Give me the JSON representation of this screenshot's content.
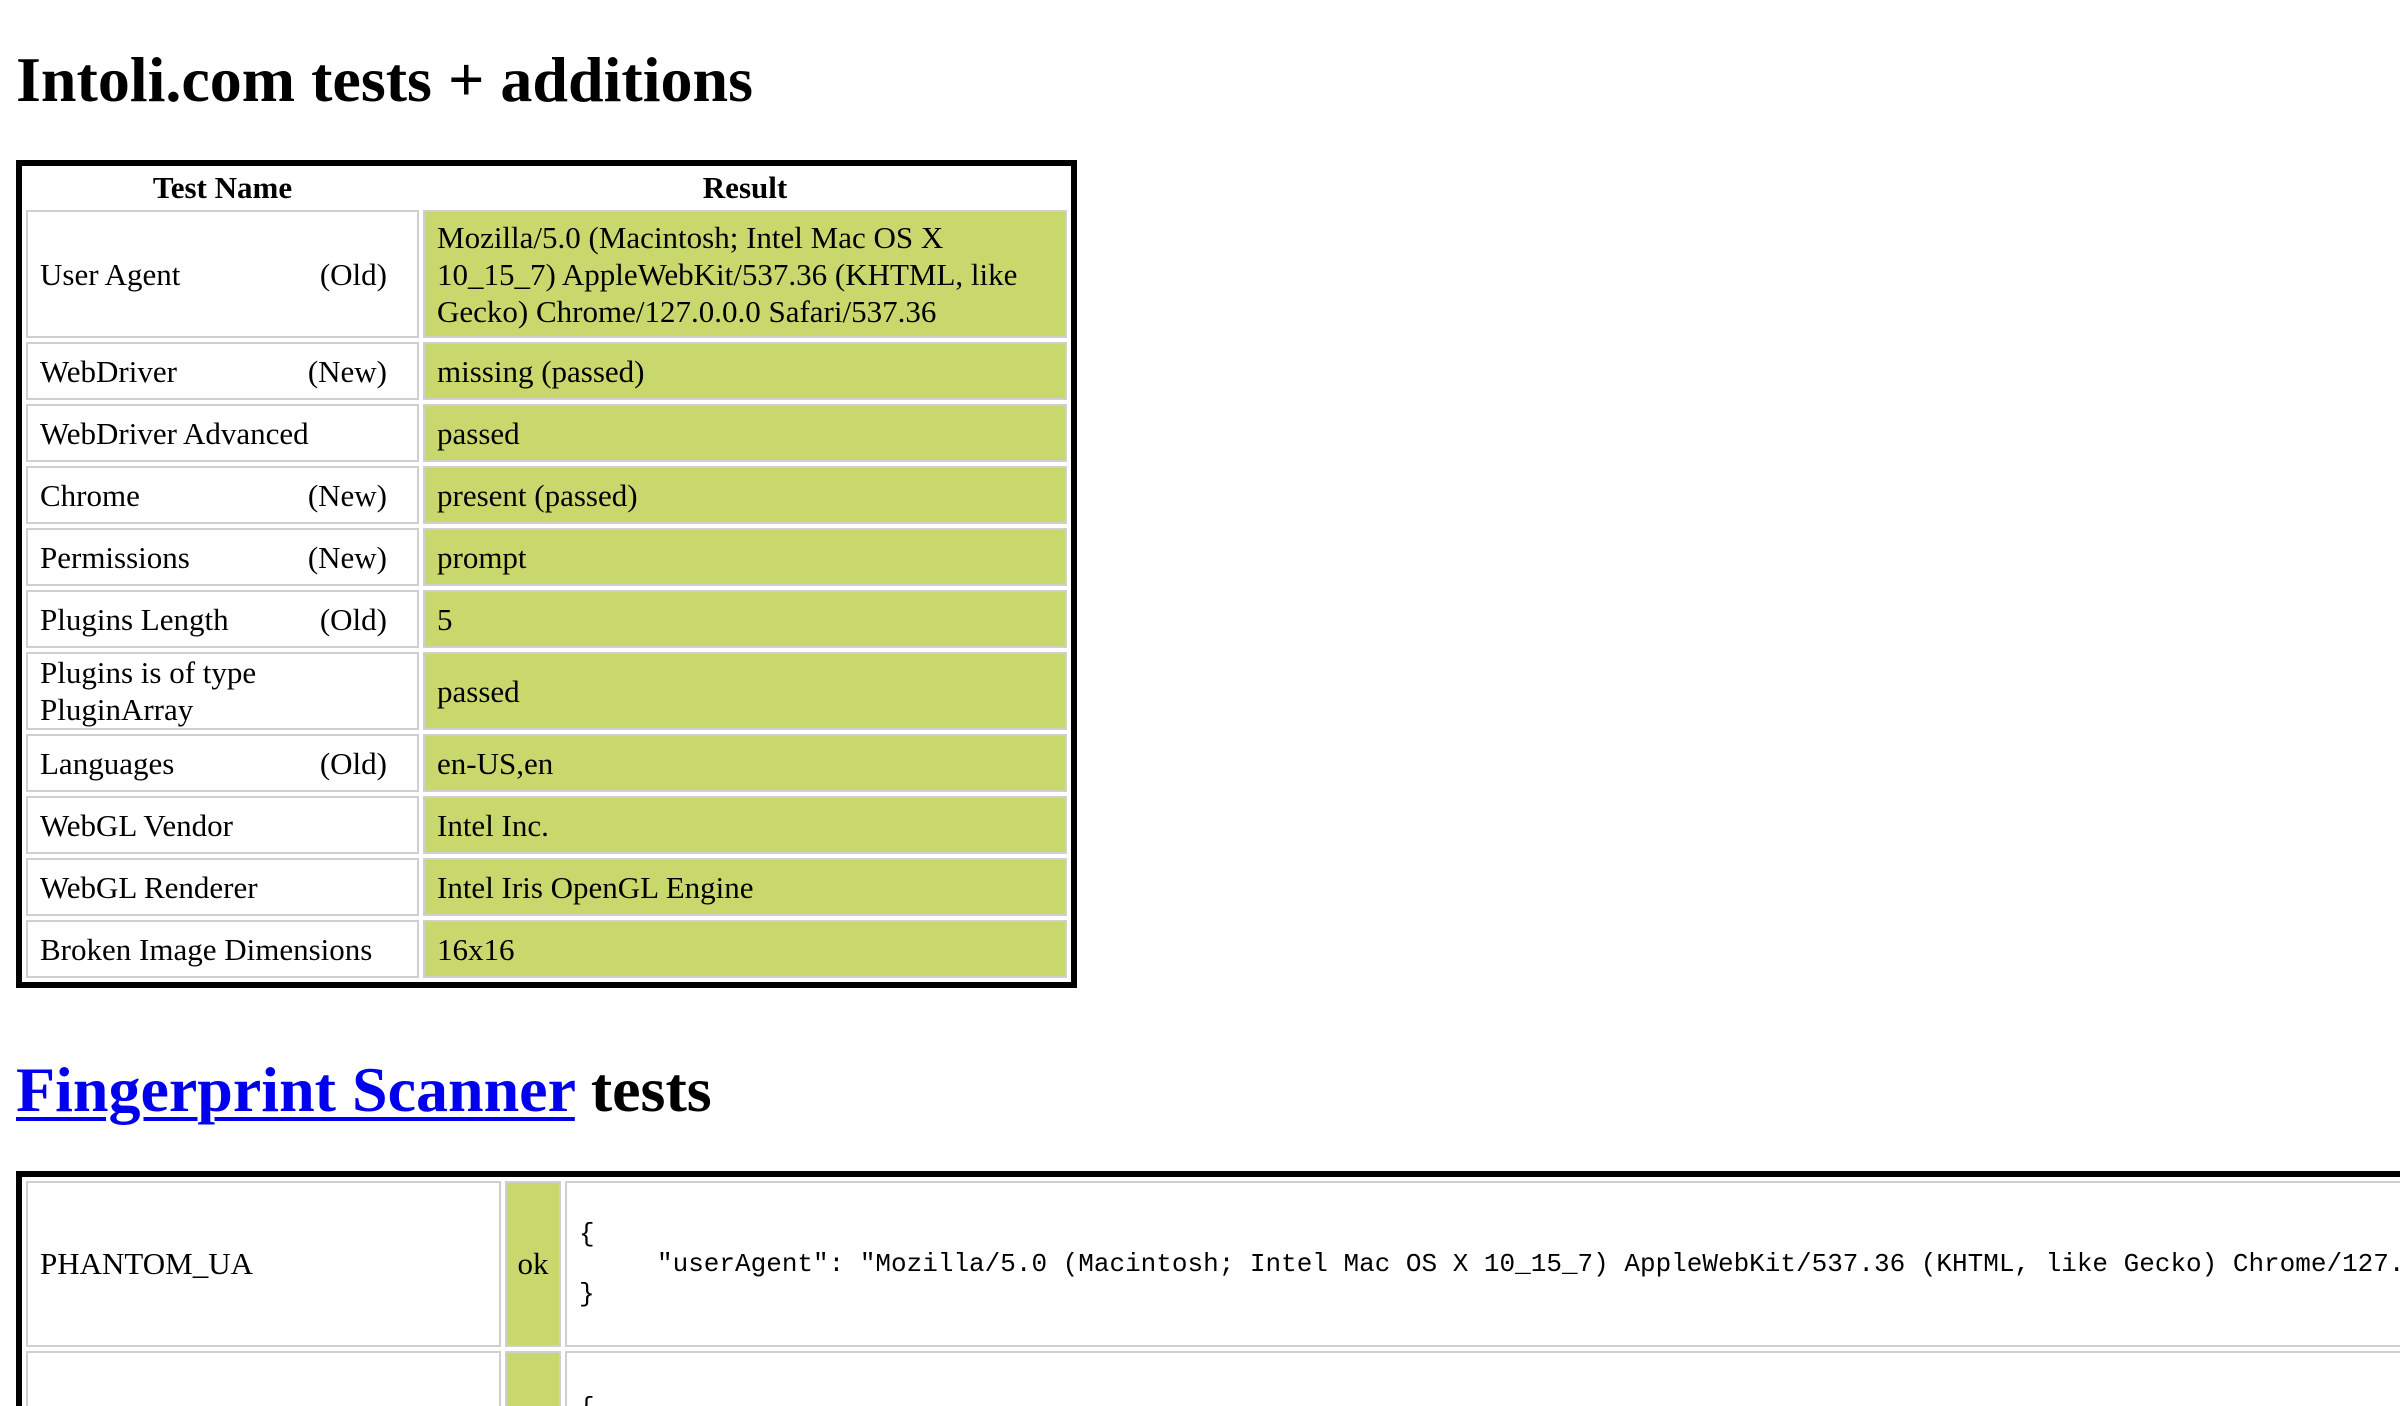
{
  "section1": {
    "title": "Intoli.com tests + additions",
    "headers": {
      "name": "Test Name",
      "result": "Result"
    },
    "rows": [
      {
        "name": "User Agent",
        "tag": "(Old)",
        "result": "Mozilla/5.0 (Macintosh; Intel Mac OS X 10_15_7) AppleWebKit/537.36 (KHTML, like Gecko) Chrome/127.0.0.0 Safari/537.36"
      },
      {
        "name": "WebDriver",
        "tag": "(New)",
        "result": "missing (passed)"
      },
      {
        "name": "WebDriver Advanced",
        "tag": "",
        "result": "passed"
      },
      {
        "name": "Chrome",
        "tag": "(New)",
        "result": "present (passed)"
      },
      {
        "name": "Permissions",
        "tag": "(New)",
        "result": "prompt"
      },
      {
        "name": "Plugins Length",
        "tag": "(Old)",
        "result": "5"
      },
      {
        "name": "Plugins is of type PluginArray",
        "tag": "",
        "result": "passed"
      },
      {
        "name": "Languages",
        "tag": "(Old)",
        "result": "en-US,en"
      },
      {
        "name": "WebGL Vendor",
        "tag": "",
        "result": "Intel Inc."
      },
      {
        "name": "WebGL Renderer",
        "tag": "",
        "result": "Intel Iris OpenGL Engine"
      },
      {
        "name": "Broken Image Dimensions",
        "tag": "",
        "result": "16x16"
      }
    ],
    "colors": {
      "result_bg": "#c9d86d",
      "border": "#000000"
    }
  },
  "section2": {
    "title_link": "Fingerprint Scanner",
    "title_rest": " tests",
    "link_color": "#0000ee",
    "rows": [
      {
        "name": "PHANTOM_UA",
        "status": "ok",
        "json_open": "{",
        "json_body": "\"userAgent\": \"Mozilla/5.0 (Macintosh; Intel Mac OS X 10_15_7) AppleWebKit/537.36 (KHTML, like Gecko) Chrome/127.",
        "json_close": "}"
      },
      {
        "name": "",
        "status": "",
        "json_open": "{"
      }
    ]
  }
}
